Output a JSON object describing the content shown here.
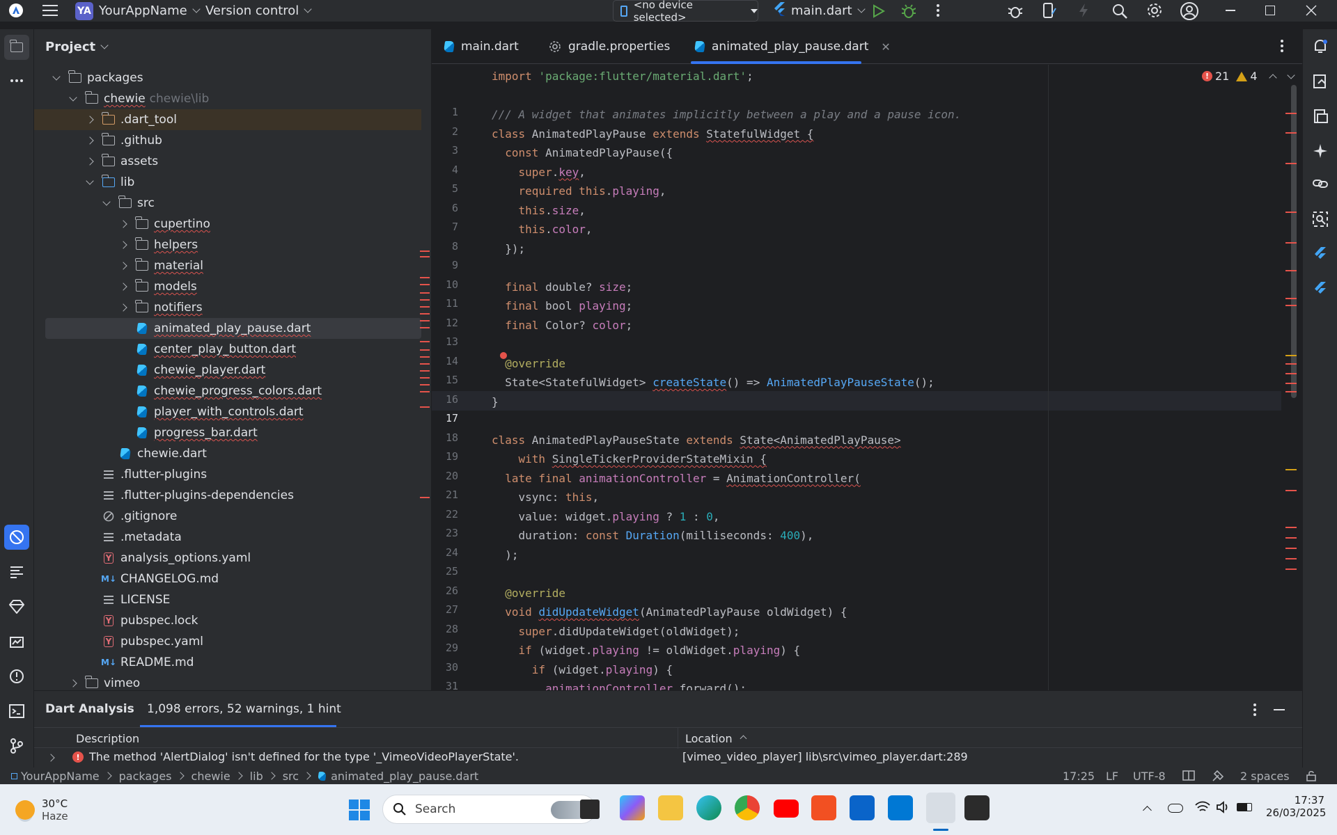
{
  "titlebar": {
    "avatar_initials": "YA",
    "project_name": "YourAppName",
    "vcs_label": "Version control",
    "device_label": "<no device selected>",
    "run_config": "main.dart"
  },
  "project_panel": {
    "title": "Project",
    "tree": [
      {
        "label": "packages",
        "indent": 1,
        "kind": "folder",
        "state": "open"
      },
      {
        "label": "chewie",
        "suffix": "chewie\\lib",
        "indent": 2,
        "kind": "module",
        "state": "open"
      },
      {
        "label": ".dart_tool",
        "indent": 3,
        "kind": "folder-orange",
        "state": "closed"
      },
      {
        "label": ".github",
        "indent": 3,
        "kind": "folder",
        "state": "closed"
      },
      {
        "label": "assets",
        "indent": 3,
        "kind": "folder",
        "state": "closed"
      },
      {
        "label": "lib",
        "indent": 3,
        "kind": "folder-blue",
        "state": "open"
      },
      {
        "label": "src",
        "indent": 4,
        "kind": "folder",
        "state": "open"
      },
      {
        "label": "cupertino",
        "indent": 5,
        "kind": "folder",
        "state": "closed"
      },
      {
        "label": "helpers",
        "indent": 5,
        "kind": "folder",
        "state": "closed"
      },
      {
        "label": "material",
        "indent": 5,
        "kind": "folder",
        "state": "closed"
      },
      {
        "label": "models",
        "indent": 5,
        "kind": "folder",
        "state": "closed"
      },
      {
        "label": "notifiers",
        "indent": 5,
        "kind": "folder",
        "state": "closed"
      },
      {
        "label": "animated_play_pause.dart",
        "indent": 5,
        "kind": "dart",
        "selected": true
      },
      {
        "label": "center_play_button.dart",
        "indent": 5,
        "kind": "dart"
      },
      {
        "label": "chewie_player.dart",
        "indent": 5,
        "kind": "dart"
      },
      {
        "label": "chewie_progress_colors.dart",
        "indent": 5,
        "kind": "dart"
      },
      {
        "label": "player_with_controls.dart",
        "indent": 5,
        "kind": "dart"
      },
      {
        "label": "progress_bar.dart",
        "indent": 5,
        "kind": "dart"
      },
      {
        "label": "chewie.dart",
        "indent": 4,
        "kind": "dart"
      },
      {
        "label": ".flutter-plugins",
        "indent": 3,
        "kind": "text"
      },
      {
        "label": ".flutter-plugins-dependencies",
        "indent": 3,
        "kind": "text"
      },
      {
        "label": ".gitignore",
        "indent": 3,
        "kind": "ignore"
      },
      {
        "label": ".metadata",
        "indent": 3,
        "kind": "text"
      },
      {
        "label": "analysis_options.yaml",
        "indent": 3,
        "kind": "yaml"
      },
      {
        "label": "CHANGELOG.md",
        "indent": 3,
        "kind": "md"
      },
      {
        "label": "LICENSE",
        "indent": 3,
        "kind": "text"
      },
      {
        "label": "pubspec.lock",
        "indent": 3,
        "kind": "yaml"
      },
      {
        "label": "pubspec.yaml",
        "indent": 3,
        "kind": "yaml"
      },
      {
        "label": "README.md",
        "indent": 3,
        "kind": "md"
      },
      {
        "label": "vimeo",
        "indent": 2,
        "kind": "module",
        "state": "closed"
      }
    ]
  },
  "editor": {
    "tabs": [
      {
        "label": "main.dart",
        "icon": "dart-icon"
      },
      {
        "label": "gradle.properties",
        "icon": "gear-icon"
      },
      {
        "label": "animated_play_pause.dart",
        "icon": "dart-icon",
        "active": true
      }
    ],
    "error_count": "21",
    "warning_count": "4",
    "lines": [
      [
        [
          "kw",
          "import "
        ],
        [
          "str",
          "'package:flutter/material.dart'"
        ],
        [
          "ty",
          ";"
        ]
      ],
      [],
      [
        [
          "cm",
          "/// A widget that animates implicitly between a play and a pause icon."
        ]
      ],
      [
        [
          "kw",
          "class "
        ],
        [
          "ty",
          "AnimatedPlayPause "
        ],
        [
          "kw",
          "extends "
        ],
        [
          "ty",
          "StatefulWidget {"
        ]
      ],
      [
        [
          "ty",
          "  "
        ],
        [
          "kw",
          "const "
        ],
        [
          "ty",
          "AnimatedPlayPause({"
        ]
      ],
      [
        [
          "ty",
          "    "
        ],
        [
          "kw",
          "super"
        ],
        [
          "ty",
          "."
        ],
        [
          "fld",
          "key"
        ],
        [
          "ty",
          ","
        ]
      ],
      [
        [
          "ty",
          "    "
        ],
        [
          "kw",
          "required this"
        ],
        [
          "ty",
          "."
        ],
        [
          "fld",
          "playing"
        ],
        [
          "ty",
          ","
        ]
      ],
      [
        [
          "ty",
          "    "
        ],
        [
          "kw",
          "this"
        ],
        [
          "ty",
          "."
        ],
        [
          "fld",
          "size"
        ],
        [
          "ty",
          ","
        ]
      ],
      [
        [
          "ty",
          "    "
        ],
        [
          "kw",
          "this"
        ],
        [
          "ty",
          "."
        ],
        [
          "fld",
          "color"
        ],
        [
          "ty",
          ","
        ]
      ],
      [
        [
          "ty",
          "  });"
        ]
      ],
      [],
      [
        [
          "ty",
          "  "
        ],
        [
          "kw",
          "final "
        ],
        [
          "ty",
          "double? "
        ],
        [
          "fld",
          "size"
        ],
        [
          "ty",
          ";"
        ]
      ],
      [
        [
          "ty",
          "  "
        ],
        [
          "kw",
          "final "
        ],
        [
          "ty",
          "bool "
        ],
        [
          "fld",
          "playing"
        ],
        [
          "ty",
          ";"
        ]
      ],
      [
        [
          "ty",
          "  "
        ],
        [
          "kw",
          "final "
        ],
        [
          "ty",
          "Color? "
        ],
        [
          "fld",
          "color"
        ],
        [
          "ty",
          ";"
        ]
      ],
      [],
      [
        [
          "ty",
          "  "
        ],
        [
          "ann",
          "@override"
        ]
      ],
      [
        [
          "ty",
          "  State<StatefulWidget> "
        ],
        [
          "fn",
          "createState"
        ],
        [
          "ty",
          "() => "
        ],
        [
          "fn",
          "AnimatedPlayPauseState"
        ],
        [
          "ty",
          "();"
        ]
      ],
      [
        [
          "ty",
          "}"
        ]
      ],
      [],
      [
        [
          "kw",
          "class "
        ],
        [
          "ty",
          "AnimatedPlayPauseState "
        ],
        [
          "kw",
          "extends "
        ],
        [
          "ty",
          "State<AnimatedPlayPause>"
        ]
      ],
      [
        [
          "ty",
          "    "
        ],
        [
          "kw",
          "with "
        ],
        [
          "ty",
          "SingleTickerProviderStateMixin {"
        ]
      ],
      [
        [
          "ty",
          "  "
        ],
        [
          "kw",
          "late final "
        ],
        [
          "fld",
          "animationController"
        ],
        [
          "ty",
          " = "
        ],
        [
          "ty",
          "AnimationController("
        ]
      ],
      [
        [
          "ty",
          "    vsync: "
        ],
        [
          "kw",
          "this"
        ],
        [
          "ty",
          ","
        ]
      ],
      [
        [
          "ty",
          "    value: widget."
        ],
        [
          "fld",
          "playing"
        ],
        [
          "ty",
          " ? "
        ],
        [
          "num",
          "1"
        ],
        [
          "ty",
          " : "
        ],
        [
          "num",
          "0"
        ],
        [
          "ty",
          ","
        ]
      ],
      [
        [
          "ty",
          "    duration: "
        ],
        [
          "kw",
          "const "
        ],
        [
          "fn",
          "Duration"
        ],
        [
          "ty",
          "(milliseconds: "
        ],
        [
          "num",
          "400"
        ],
        [
          "ty",
          "),"
        ]
      ],
      [
        [
          "ty",
          "  );"
        ]
      ],
      [],
      [
        [
          "ty",
          "  "
        ],
        [
          "ann",
          "@override"
        ]
      ],
      [
        [
          "ty",
          "  "
        ],
        [
          "kw",
          "void "
        ],
        [
          "fn",
          "didUpdateWidget"
        ],
        [
          "ty",
          "(AnimatedPlayPause oldWidget) {"
        ]
      ],
      [
        [
          "ty",
          "    "
        ],
        [
          "kw",
          "super"
        ],
        [
          "ty",
          ".didUpdateWidget(oldWidget);"
        ]
      ],
      [
        [
          "ty",
          "    "
        ],
        [
          "kw",
          "if "
        ],
        [
          "ty",
          "(widget."
        ],
        [
          "fld",
          "playing"
        ],
        [
          "ty",
          " != oldWidget."
        ],
        [
          "fld",
          "playing"
        ],
        [
          "ty",
          ") {"
        ]
      ],
      [
        [
          "ty",
          "      "
        ],
        [
          "kw",
          "if "
        ],
        [
          "ty",
          "(widget."
        ],
        [
          "fld",
          "playing"
        ],
        [
          "ty",
          ") {"
        ]
      ],
      [
        [
          "ty",
          "        "
        ],
        [
          "fld",
          "animationController"
        ],
        [
          "ty",
          ".forward();"
        ]
      ]
    ]
  },
  "dart_analysis": {
    "title": "Dart Analysis",
    "summary": "1,098 errors, 52 warnings, 1 hint",
    "col_description": "Description",
    "col_location": "Location",
    "rows": [
      {
        "description": "The method 'AlertDialog' isn't defined for the type '_VimeoVideoPlayerState'.",
        "location": "[vimeo_video_player] lib\\src\\vimeo_player.dart:289"
      }
    ]
  },
  "statusbar": {
    "breadcrumb": [
      "YourAppName",
      "packages",
      "chewie",
      "lib",
      "src",
      "animated_play_pause.dart"
    ],
    "caret_pos": "17:25",
    "line_sep": "LF",
    "encoding": "UTF-8",
    "indent": "2 spaces"
  },
  "taskbar": {
    "weather_temp": "30°C",
    "weather_desc": "Haze",
    "search_placeholder": "Search",
    "time": "17:37",
    "date": "26/03/2025"
  },
  "colors": {
    "error": "#e5534b",
    "warning": "#d4a017",
    "accent": "#3574f0"
  }
}
